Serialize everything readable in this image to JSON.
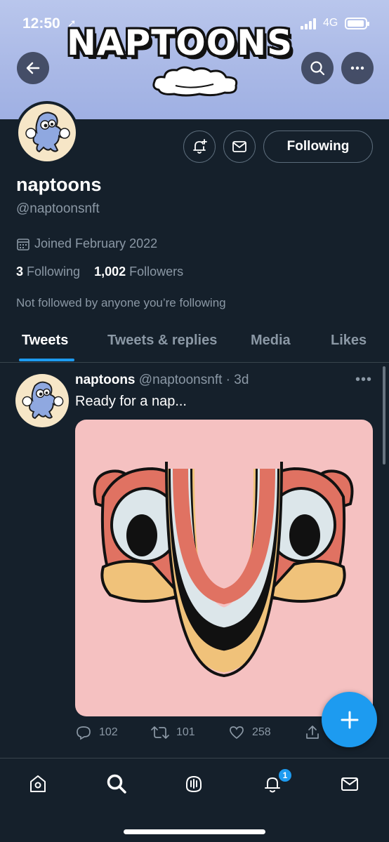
{
  "status_bar": {
    "time": "12:50",
    "network": "4G"
  },
  "banner": {
    "logo_text": "NAPTOONS"
  },
  "profile": {
    "name": "naptoons",
    "handle": "@naptoonsnft",
    "joined": "Joined February 2022",
    "following_count": "3",
    "following_label": "Following",
    "followers_count": "1,002",
    "followers_label": "Followers",
    "not_followed_text": "Not followed by anyone you’re following",
    "follow_button_label": "Following"
  },
  "tabs": [
    {
      "label": "Tweets",
      "active": true
    },
    {
      "label": "Tweets & replies",
      "active": false
    },
    {
      "label": "Media",
      "active": false
    },
    {
      "label": "Likes",
      "active": false
    }
  ],
  "tweet": {
    "name": "naptoons",
    "handle": "@naptoonsnft",
    "time": "· 3d",
    "text": "Ready for a nap...",
    "replies": "102",
    "retweets": "101",
    "likes": "258"
  },
  "nav": {
    "notifications_badge": "1"
  },
  "colors": {
    "background": "#15202b",
    "accent": "#1d9bf0",
    "muted": "#8b98a5",
    "media_bg": "#f5c1c1"
  }
}
